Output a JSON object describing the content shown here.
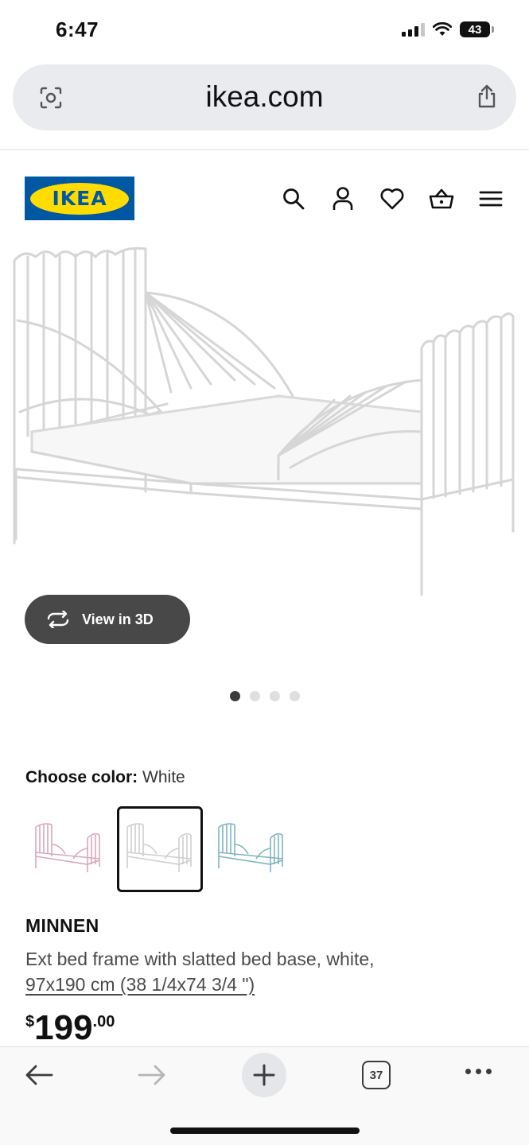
{
  "status_bar": {
    "time": "6:47",
    "battery": "43",
    "icons": [
      "cellular-signal-icon",
      "wifi-icon",
      "battery-icon"
    ]
  },
  "browser": {
    "url": "ikea.com",
    "tab_count": "37",
    "icons": [
      "visual-search-icon",
      "share-icon",
      "back-arrow-icon",
      "forward-arrow-icon",
      "new-tab-plus-icon",
      "more-icon"
    ]
  },
  "site_header": {
    "logo_text": "IKEA",
    "logo_colors": {
      "blue": "#0058a3",
      "yellow": "#ffdb00"
    },
    "icons": [
      "search-icon",
      "account-icon",
      "wishlist-heart-icon",
      "shopping-basket-icon",
      "menu-icon"
    ]
  },
  "product": {
    "view_3d_label": "View in 3D",
    "gallery": {
      "count": 4,
      "active": 1
    },
    "choose_color_label": "Choose color:",
    "selected_color": "White",
    "color_options": [
      {
        "color": "pink",
        "hex": "#d9a7bd",
        "selected": false
      },
      {
        "color": "white",
        "hex": "#cfcfcf",
        "selected": true
      },
      {
        "color": "turquoise",
        "hex": "#7fb4bd",
        "selected": false
      }
    ],
    "name": "MINNEN",
    "description": "Ext bed frame with slatted bed base, white,",
    "size": "97x190 cm (38 1/4x74 3/4 \")",
    "price": {
      "currency": "$",
      "main": "199",
      "cents": ".00"
    }
  }
}
